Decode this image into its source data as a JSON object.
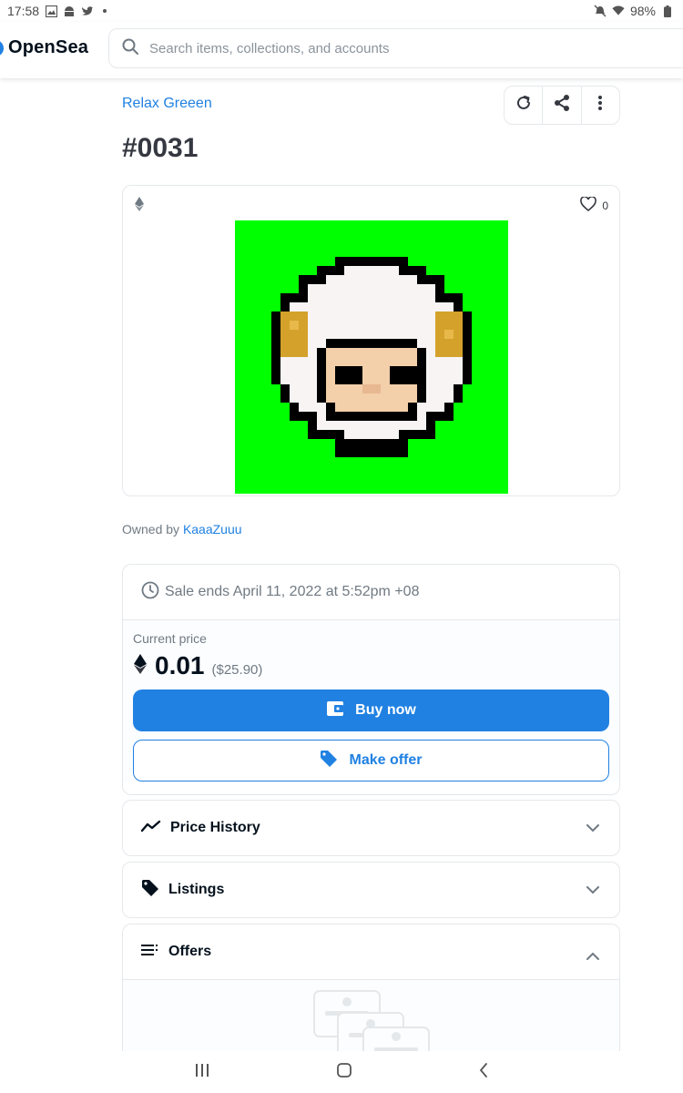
{
  "status_bar": {
    "time": "17:58",
    "battery": "98%",
    "icons_left": [
      "gallery-icon",
      "android-icon",
      "twitter-icon",
      "dot-icon"
    ],
    "icons_right": [
      "mute-icon",
      "wifi-icon",
      "battery-icon"
    ]
  },
  "header": {
    "brand": "OpenSea",
    "search_placeholder": "Search items, collections, and accounts"
  },
  "item": {
    "collection": "Relax Greeen",
    "title": "#0031",
    "favorites": "0",
    "owned_by_prefix": "Owned by",
    "owner": "KaaaZuuu"
  },
  "trade": {
    "sale_ends": "Sale ends April 11, 2022 at 5:52pm +08",
    "current_price_label": "Current price",
    "price": "0.01",
    "price_usd": "($25.90)",
    "buy_label": "Buy now",
    "offer_label": "Make offer"
  },
  "panels": [
    {
      "label": "Price History",
      "icon": "trend-icon",
      "expanded": false
    },
    {
      "label": "Listings",
      "icon": "tag-icon",
      "expanded": false
    },
    {
      "label": "Offers",
      "icon": "list-icon",
      "expanded": true
    }
  ],
  "colors": {
    "accent": "#2081e2",
    "nft_background": "#00ff00",
    "border": "#e5e8eb"
  }
}
